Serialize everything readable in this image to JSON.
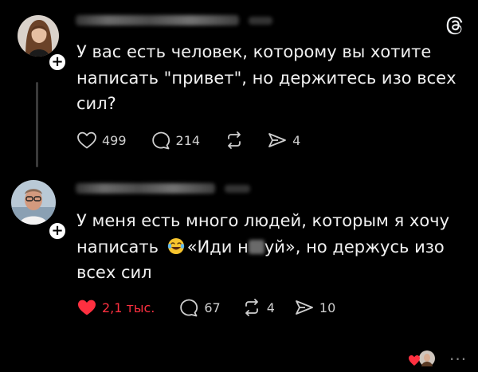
{
  "app": {
    "logo_icon": "threads-logo-icon"
  },
  "posts": [
    {
      "username": "",
      "text": "У вас есть человек, которому вы хотите\nнаписать \"привет\", но держитесь изо всех\nсил?",
      "likes": "499",
      "comments": "214",
      "reposts": "",
      "shares": "4",
      "liked": false
    },
    {
      "username": "",
      "text_part1": "У меня есть много людей, которым я хочу\nнаписать ",
      "emoji_icon": "face-with-tears-of-joy-icon",
      "text_part2": "«Иди н",
      "text_part3": "уй», но держусь изо\nвсех сил",
      "likes": "2,1 тыс.",
      "comments": "67",
      "reposts": "4",
      "shares": "10",
      "liked": true
    }
  ],
  "colors": {
    "background": "#000000",
    "text": "#f3f5f7",
    "muted": "#cfcfcf",
    "like_active": "#ff3040"
  }
}
